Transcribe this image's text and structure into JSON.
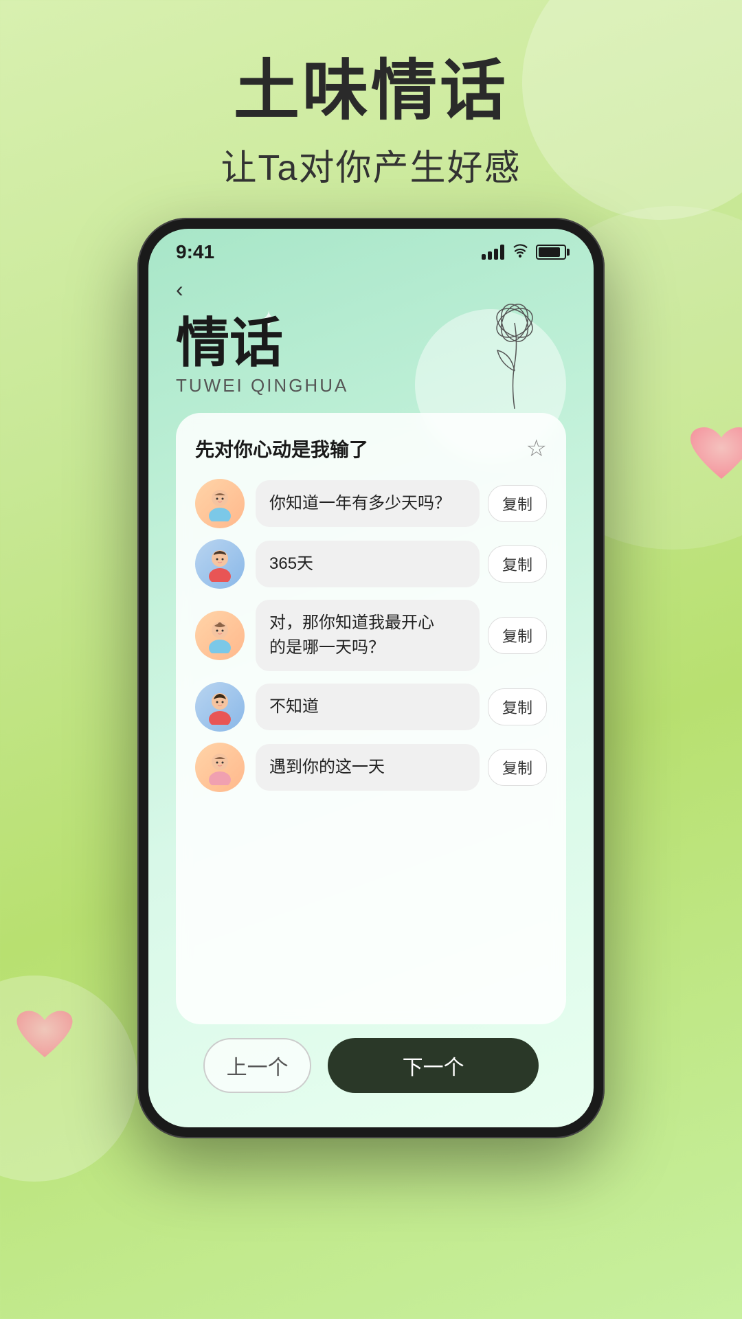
{
  "header": {
    "main_title": "土味情话",
    "subtitle": "让Ta对你产生好感"
  },
  "status_bar": {
    "time": "9:41"
  },
  "phone": {
    "page_title_cn": "情话",
    "page_title_en": "TUWEI QINGHUA",
    "card_title": "先对你心动是我输了",
    "star_label": "☆",
    "chat_items": [
      {
        "id": 1,
        "avatar_type": "girl",
        "text": "你知道一年有多少天吗？",
        "copy_label": "复制"
      },
      {
        "id": 2,
        "avatar_type": "boy",
        "text": "365天",
        "copy_label": "复制"
      },
      {
        "id": 3,
        "avatar_type": "girl",
        "text": "对，那你知道我最开心的是哪一天吗？",
        "copy_label": "复制"
      },
      {
        "id": 4,
        "avatar_type": "boy",
        "text": "不知道",
        "copy_label": "复制"
      },
      {
        "id": 5,
        "avatar_type": "girl",
        "text": "遇到你的这一天",
        "copy_label": "复制"
      }
    ],
    "nav": {
      "prev_label": "上一个",
      "next_label": "下一个"
    }
  }
}
